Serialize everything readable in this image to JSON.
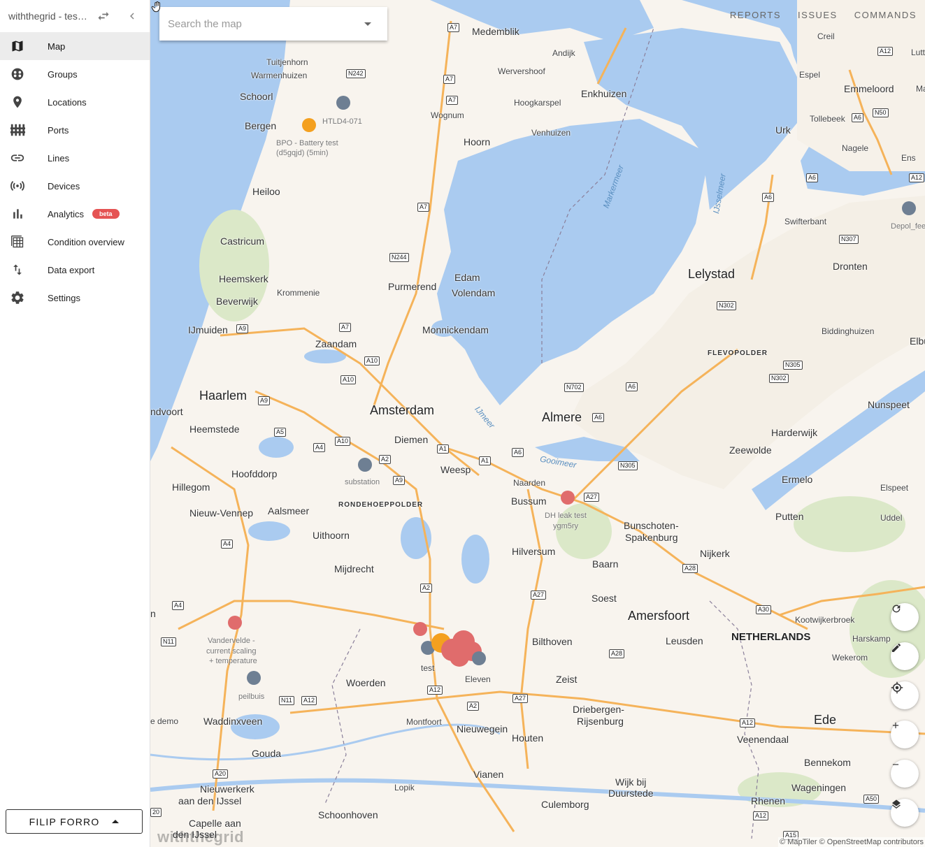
{
  "sidebar": {
    "title": "withthegrid - tes…",
    "nav": [
      {
        "label": "Map",
        "icon": "map-icon",
        "active": true
      },
      {
        "label": "Groups",
        "icon": "groups-icon"
      },
      {
        "label": "Locations",
        "icon": "location-pin-icon"
      },
      {
        "label": "Ports",
        "icon": "ports-icon"
      },
      {
        "label": "Lines",
        "icon": "link-icon"
      },
      {
        "label": "Devices",
        "icon": "broadcast-icon"
      },
      {
        "label": "Analytics",
        "icon": "bar-chart-icon",
        "badge": "beta"
      },
      {
        "label": "Condition overview",
        "icon": "table-icon"
      },
      {
        "label": "Data export",
        "icon": "sort-arrows-icon"
      },
      {
        "label": "Settings",
        "icon": "gear-icon"
      }
    ],
    "user": "FILIP FORRO"
  },
  "search": {
    "placeholder": "Search the map"
  },
  "topnav": {
    "reports": "REPORTS",
    "issues": "ISSUES",
    "commands": "COMMANDS"
  },
  "map": {
    "places": {
      "medemblik": "Medemblik",
      "andijk": "Andijk",
      "wervershoof": "Wervershoof",
      "enkhuizen": "Enkhuizen",
      "hoogkarspel": "Hoogkarspel",
      "venhuizen": "Venhuizen",
      "hoorn": "Hoorn",
      "wognum": "Wognum",
      "tuitjenhorn": "Tuitjenhorn",
      "warmenhuizen": "Warmenhuizen",
      "schoorl": "Schoorl",
      "bergen": "Bergen",
      "heiloo": "Heiloo",
      "castricum": "Castricum",
      "heemskerk": "Heemskerk",
      "beverwijk": "Beverwijk",
      "krommenie": "Krommenie",
      "ijmuiden": "IJmuiden",
      "zaandam": "Zaandam",
      "purmerend": "Purmerend",
      "edam": "Edam",
      "volendam": "Volendam",
      "monnickendam": "Monnickendam",
      "haarlem": "Haarlem",
      "amsterdam": "Amsterdam",
      "zandvoort": "ndvoort",
      "heemstede": "Heemstede",
      "diemen": "Diemen",
      "almere": "Almere",
      "weesp": "Weesp",
      "hoofddorp": "Hoofddorp",
      "hillegom": "Hillegom",
      "naarden": "Naarden",
      "bussum": "Bussum",
      "nieuw_vennep": "Nieuw-Vennep",
      "aalsmeer": "Aalsmeer",
      "uithoorn": "Uithoorn",
      "hilversum": "Hilversum",
      "mijdrecht": "Mijdrecht",
      "baarn": "Baarn",
      "soest": "Soest",
      "amersfoort": "Amersfoort",
      "bilthoven": "Bilthoven",
      "leusden": "Leusden",
      "zeist": "Zeist",
      "woerden": "Woerden",
      "waddinxveen": "Waddinxveen",
      "gouda": "Gouda",
      "montfoort": "Montfoort",
      "nieuwegein": "Nieuwegein",
      "houten": "Houten",
      "driebergen": "Driebergen-",
      "rijsenburg": "Rijsenburg",
      "vianen": "Vianen",
      "lopik": "Lopik",
      "schoonhoven": "Schoonhoven",
      "culemborg": "Culemborg",
      "wijk_bij": "Wijk bij",
      "duurstede": "Duurstede",
      "nieuwerkerk": "Nieuwerkerk",
      "aan_den_ijssel": "aan den IJssel",
      "capelle": "Capelle aan",
      "den_ijssel": "den IJssel",
      "lelystad": "Lelystad",
      "dronten": "Dronten",
      "swifterbant": "Swifterbant",
      "biddinghuizen": "Biddinghuizen",
      "elburg": "Elbu",
      "nunspeet": "Nunspeet",
      "harderwijk": "Harderwijk",
      "zeewolde": "Zeewolde",
      "ermelo": "Ermelo",
      "elspeet": "Elspeet",
      "putten": "Putten",
      "uddel": "Uddel",
      "nijkerk": "Nijkerk",
      "bunschoten": "Bunschoten-",
      "spakenburg": "Spakenburg",
      "kootwijkerbroek": "Kootwijkerbroek",
      "harskamp": "Harskamp",
      "wekerom": "Wekerom",
      "ede": "Ede",
      "veenendaal": "Veenendaal",
      "bennekom": "Bennekom",
      "wageningen": "Wageningen",
      "rhenen": "Rhenen",
      "urk": "Urk",
      "creil": "Creil",
      "espel": "Espel",
      "emmeloord": "Emmeloord",
      "tollebeek": "Tollebeek",
      "nagele": "Nagele",
      "ens": "Ens",
      "lutten": "Lutt",
      "eleven": "Eleven",
      "test": "test",
      "n_edge": "n",
      "demo": "e demo",
      "marl": "Ma"
    },
    "regions": {
      "flevopolder": "FLEVOPOLDER",
      "rondehoep": "RONDEHOEPPOLDER",
      "netherlands": "NETHERLANDS"
    },
    "water": {
      "markermeer": "Markermeer",
      "ijsselmeer": "IJsselmeer",
      "ijmeer": "IJmeer",
      "gooimeer": "Gooimeer"
    },
    "markers": {
      "htld": "HTLD4-071",
      "bpo_1": "BPO - Battery test",
      "bpo_2": "(d5gqjd) (5min)",
      "substation": "substation",
      "dh_1": "DH leak test",
      "dh_2": "ygm5ry",
      "vdv_1": "Vandervelde -",
      "vdv_2": "current scaling",
      "vdv_3": "+ temperature",
      "peilbuis": "peilbuis",
      "depol": "Depol_feedb"
    },
    "roads": [
      "A7",
      "A7",
      "A7",
      "A7",
      "N242",
      "A7",
      "N244",
      "A9",
      "A10",
      "A10",
      "A9",
      "A5",
      "A4",
      "A10",
      "A2",
      "A9",
      "A1",
      "A1",
      "A6",
      "A6",
      "A6",
      "N702",
      "N305",
      "A27",
      "A27",
      "A28",
      "A28",
      "A2",
      "A2",
      "A12",
      "A12",
      "A27",
      "N11",
      "A12",
      "N11",
      "A4",
      "A4",
      "A20",
      "A30",
      "A12",
      "A50",
      "N302",
      "N305",
      "N302",
      "N307",
      "A6",
      "A6",
      "N50",
      "A6",
      "A15",
      "20",
      "A12",
      "A12"
    ],
    "attribution": "© MapTiler © OpenStreetMap contributors",
    "watermark": "withthegrid"
  },
  "controls": [
    "refresh-icon",
    "edit-icon",
    "locate-icon",
    "zoom-in-icon",
    "zoom-out-icon",
    "layers-icon"
  ],
  "colors": {
    "water": "#aacbf0",
    "land": "#f8f4ee",
    "motorway": "#f5b35a",
    "marker_red": "#e06c6c",
    "marker_orange": "#f4a01f",
    "marker_gray": "#6e7f93",
    "beta": "#e55353"
  }
}
